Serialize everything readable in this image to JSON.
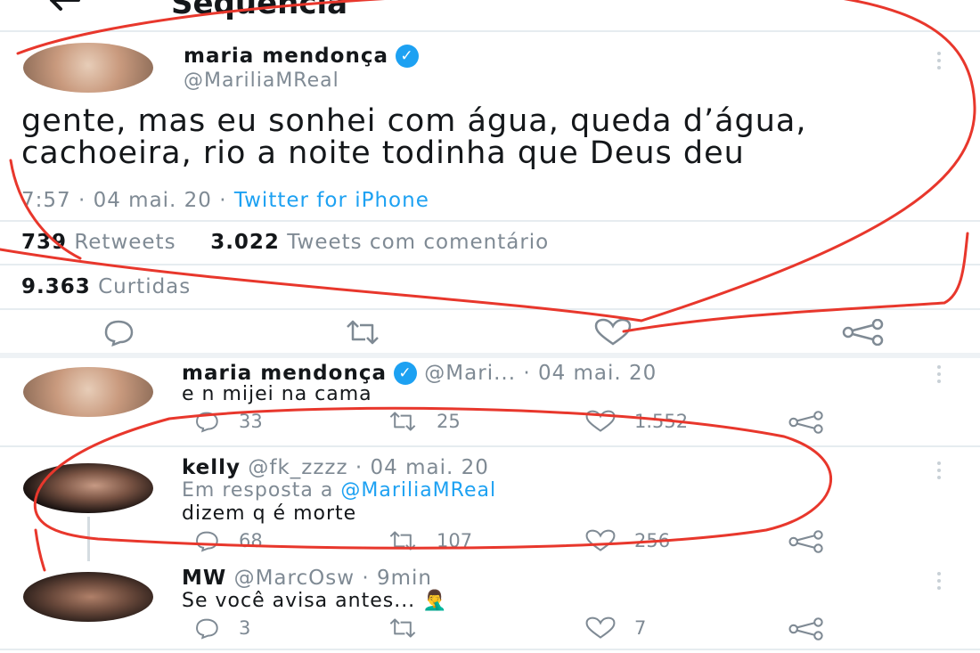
{
  "header": {
    "title": "Sequência"
  },
  "main_tweet": {
    "display_name": "maria mendonça",
    "handle": "@MariliaMReal",
    "text": "gente, mas eu sonhei com água, queda d’água, cachoeira, rio a noite todinha que Deus deu",
    "time_date": "7:57 · 04 mai. 20 ·",
    "source": "Twitter for iPhone",
    "retweets_count": "739",
    "retweets_label": "Retweets",
    "quotes_count": "3.022",
    "quotes_label": "Tweets com comentário",
    "likes_count": "9.363",
    "likes_label": "Curtidas"
  },
  "replies": [
    {
      "display_name": "maria mendonça",
      "handle": "@Mari...",
      "date": "· 04 mai. 20",
      "text": "e n mijei na cama",
      "reply_count": "33",
      "retweet_count": "25",
      "like_count": "1.552"
    },
    {
      "display_name": "kelly",
      "handle": "@fk_zzzz",
      "date": "· 04 mai. 20",
      "in_reply_prefix": "Em resposta a",
      "in_reply_handle": "@MariliaMReal",
      "text": "dizem q é morte",
      "reply_count": "68",
      "retweet_count": "107",
      "like_count": "256"
    },
    {
      "display_name": "MW",
      "handle": "@MarcOsw",
      "date": "· 9min",
      "text": "Se você avisa antes...",
      "emoji": "🤦‍♂️",
      "reply_count": "3",
      "retweet_count": "",
      "like_count": "7"
    }
  ],
  "colors": {
    "accent": "#1da1f2",
    "annotation": "#e8372c",
    "muted": "#7f8a94"
  },
  "icons": [
    "back-arrow-icon",
    "verified-icon",
    "more-icon",
    "reply-icon",
    "retweet-icon",
    "like-icon",
    "share-icon"
  ]
}
